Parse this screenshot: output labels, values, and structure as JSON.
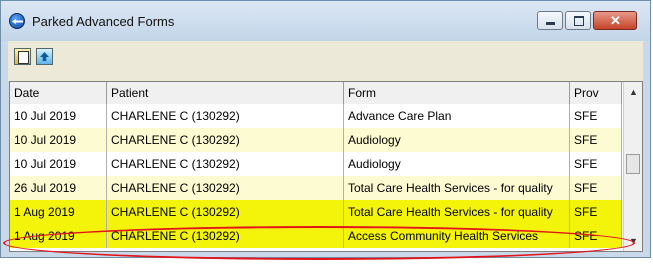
{
  "window": {
    "title": "Parked Advanced Forms"
  },
  "toolbar": {
    "buttons": [
      "print-icon",
      "upload-icon"
    ]
  },
  "table": {
    "columns": [
      "Date",
      "Patient",
      "Form",
      "Prov"
    ],
    "rows": [
      {
        "date": "10 Jul 2019",
        "patient": "CHARLENE C (130292)",
        "form": "Advance Care Plan",
        "prov": "SFE",
        "bg": "#ffffff"
      },
      {
        "date": "10 Jul 2019",
        "patient": "CHARLENE C (130292)",
        "form": "Audiology",
        "prov": "SFE",
        "bg": "#fdfbd2"
      },
      {
        "date": "10 Jul 2019",
        "patient": "CHARLENE C (130292)",
        "form": "Audiology",
        "prov": "SFE",
        "bg": "#ffffff"
      },
      {
        "date": "26 Jul 2019",
        "patient": "CHARLENE C (130292)",
        "form": "Total Care Health Services - for quality",
        "prov": "SFE",
        "bg": "#fdfbd2"
      },
      {
        "date": "1 Aug 2019",
        "patient": "CHARLENE C (130292)",
        "form": "Total Care Health Services - for quality",
        "prov": "SFE",
        "bg": "#f4f40a"
      },
      {
        "date": "1 Aug 2019",
        "patient": "CHARLENE C (130292)",
        "form": "Access Community Health Services",
        "prov": "SFE",
        "bg": "#f4f40a"
      }
    ]
  },
  "colors": {
    "highlight": "#f4f40a",
    "alt_row": "#fdfbd2",
    "annotation": "#e2151b"
  }
}
